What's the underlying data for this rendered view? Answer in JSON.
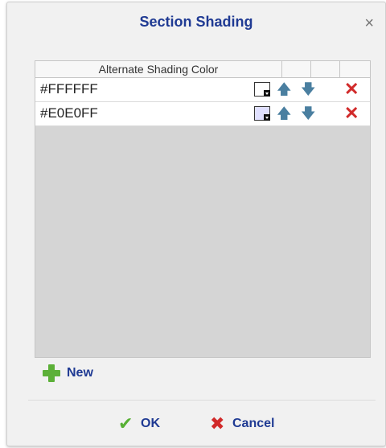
{
  "dialog": {
    "title": "Section Shading",
    "close_label": "×"
  },
  "grid": {
    "column_header": "Alternate Shading Color",
    "rows": [
      {
        "value": "#FFFFFF",
        "swatch_color": "#FFFFFF"
      },
      {
        "value": "#E0E0FF",
        "swatch_color": "#E0E0FF"
      }
    ],
    "icons": {
      "up": "arrow-up-icon",
      "down": "arrow-down-icon",
      "delete": "delete-icon"
    }
  },
  "actions": {
    "new_label": "New",
    "ok_label": "OK",
    "cancel_label": "Cancel"
  },
  "colors": {
    "accent": "#1F3A93",
    "ok": "#58B035",
    "danger": "#D12A2A",
    "arrow": "#4A7FA0"
  }
}
